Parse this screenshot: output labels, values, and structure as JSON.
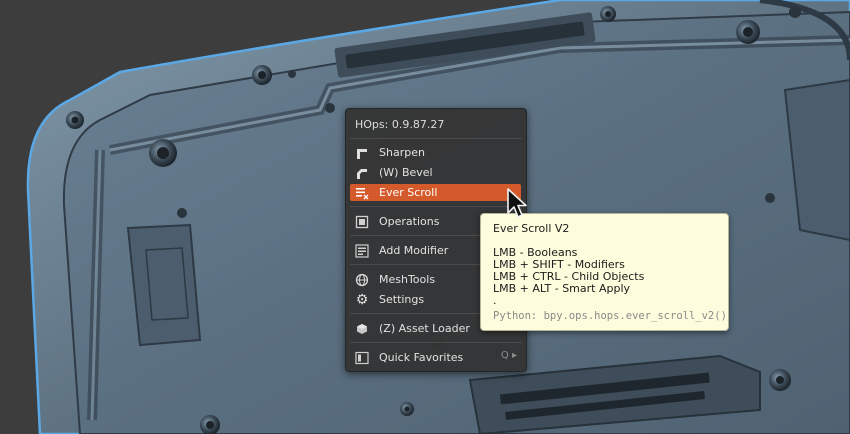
{
  "menu": {
    "title": "HOps: 0.9.87.27",
    "items": [
      {
        "label": "Sharpen",
        "icon": "sharpen-icon"
      },
      {
        "label": "(W) Bevel",
        "icon": "bevel-icon"
      },
      {
        "label": "Ever Scroll",
        "icon": "ever-scroll-icon",
        "active": true
      },
      {
        "label": "Operations",
        "icon": "operations-icon"
      },
      {
        "label": "Add Modifier",
        "icon": "add-modifier-icon"
      },
      {
        "label": "MeshTools",
        "icon": "meshtools-icon"
      },
      {
        "label": "Settings",
        "icon": "gear-icon"
      },
      {
        "label": "(Z) Asset Loader",
        "icon": "asset-loader-icon"
      },
      {
        "label": "Quick Favorites",
        "icon": "quick-favorites-icon",
        "hotkey": "Q ▸"
      }
    ]
  },
  "tooltip": {
    "title": "Ever Scroll V2",
    "lines": [
      "LMB - Booleans",
      "LMB + SHIFT - Modifiers",
      "LMB + CTRL - Child Objects",
      "LMB + ALT - Smart Apply",
      "."
    ],
    "python": "Python: bpy.ops.hops.ever_scroll_v2()"
  },
  "colors": {
    "accent": "#d45a2b",
    "menu_bg": "#343434",
    "tooltip_bg": "#fdfcdc",
    "mesh_fill": "#566b7c",
    "mesh_outline": "#5aa8e6"
  }
}
